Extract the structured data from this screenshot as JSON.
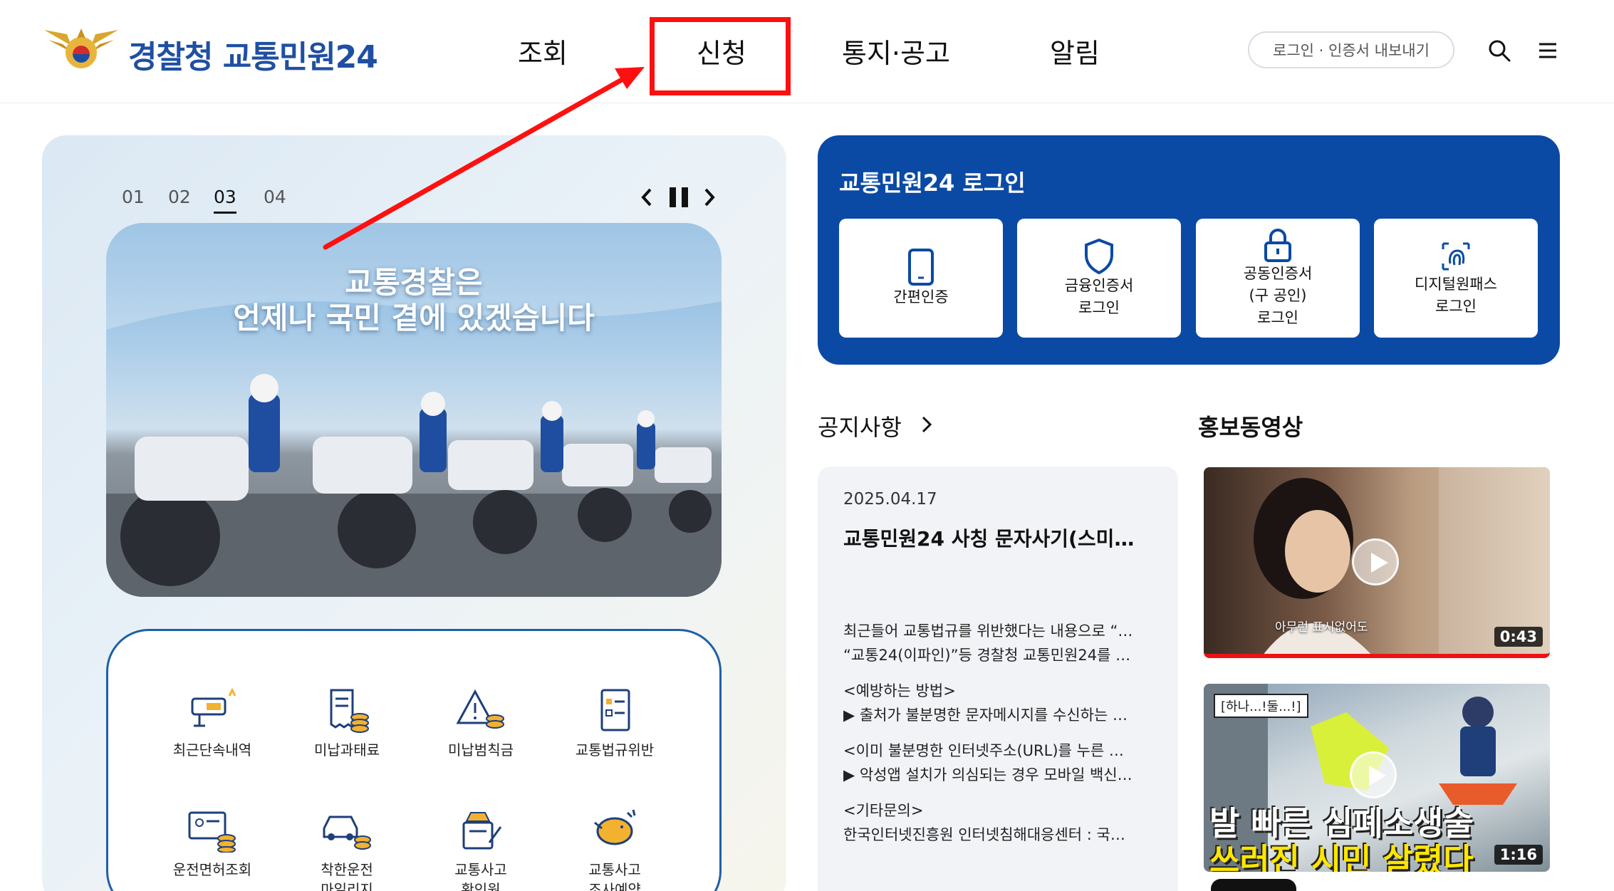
{
  "header": {
    "logo_text": "경찰청 교통민원24",
    "nav": [
      "조회",
      "신청",
      "통지·공고",
      "알림"
    ],
    "login_button": "로그인 · 인증서 내보내기",
    "search_icon": "search-icon",
    "menu_icon": "hamburger-menu-icon"
  },
  "carousel": {
    "pages": [
      "01",
      "02",
      "03",
      "04"
    ],
    "active_page": "03",
    "banner_line1": "교통경찰은",
    "banner_line2": "언제나 국민 곁에 있겠습니다"
  },
  "services": [
    {
      "label": "최근단속내역",
      "icon": "speed-camera-icon"
    },
    {
      "label": "미납과태료",
      "icon": "receipt-coins-icon"
    },
    {
      "label": "미납범칙금",
      "icon": "warning-coins-icon"
    },
    {
      "label": "교통법규위반",
      "icon": "document-checklist-icon"
    },
    {
      "label": "운전면허조회",
      "icon": "license-card-icon"
    },
    {
      "label": "착한운전\n마일리지",
      "icon": "car-coins-icon"
    },
    {
      "label": "교통사고\n확인원",
      "icon": "car-document-icon"
    },
    {
      "label": "교통사고\n조사예약",
      "icon": "piggy-bank-icon"
    }
  ],
  "login": {
    "title": "교통민원24 로그인",
    "options": [
      {
        "label": "간편인증",
        "icon": "phone-icon"
      },
      {
        "label": "금융인증서\n로그인",
        "icon": "shield-icon"
      },
      {
        "label": "공동인증서\n(구 공인)\n로그인",
        "icon": "lock-icon"
      },
      {
        "label": "디지털원패스\n로그인",
        "icon": "fingerprint-icon"
      }
    ]
  },
  "notice": {
    "heading": "공지사항",
    "date": "2025.04.17",
    "title": "교통민원24 사칭 문자사기(스미싱…",
    "lines": [
      "최근들어 교통법규를 위반했다는 내용으로 “…",
      "“교통24(이파인)”등 경찰청 교통민원24를 …",
      "<예방하는 방법>",
      "▶ 출처가 불분명한 문자메시지를 수신하는 …",
      "<이미 불분명한 인터넷주소(URL)를 누른 …",
      "▶ 악성앱 설치가 의심되는 경우 모바일 백신…",
      "<기타문의>",
      "한국인터넷진흥원 인터넷침해대응센터 : 국…"
    ]
  },
  "videos": {
    "heading": "홍보동영상",
    "items": [
      {
        "duration": "0:43",
        "caption": "아무런 표시없어도"
      },
      {
        "duration": "1:16",
        "tag": "[하나...!둘...!]",
        "title_line1": "발 빠른 심폐소생술",
        "title_line2": "쓰러진 시민 살렸다"
      }
    ]
  },
  "annotation": {
    "color": "#ff1010"
  }
}
